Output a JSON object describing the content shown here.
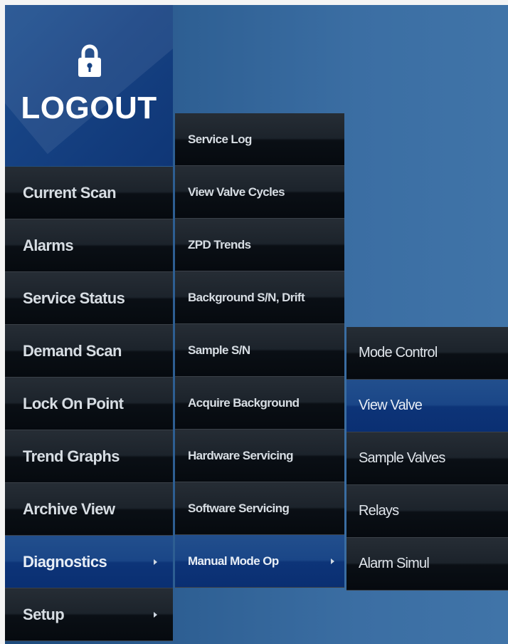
{
  "logout": {
    "label": "LOGOUT",
    "icon": "lock-icon"
  },
  "main_menu": [
    {
      "label": "Current Scan",
      "active": false,
      "has_submenu": false
    },
    {
      "label": "Alarms",
      "active": false,
      "has_submenu": false
    },
    {
      "label": "Service Status",
      "active": false,
      "has_submenu": false
    },
    {
      "label": "Demand Scan",
      "active": false,
      "has_submenu": false
    },
    {
      "label": "Lock On Point",
      "active": false,
      "has_submenu": false
    },
    {
      "label": "Trend Graphs",
      "active": false,
      "has_submenu": false
    },
    {
      "label": "Archive View",
      "active": false,
      "has_submenu": false
    },
    {
      "label": "Diagnostics",
      "active": true,
      "has_submenu": true
    },
    {
      "label": "Setup",
      "active": false,
      "has_submenu": true
    }
  ],
  "diagnostics_menu": [
    {
      "label": "Service Log",
      "active": false
    },
    {
      "label": "View Valve Cycles",
      "active": false
    },
    {
      "label": "ZPD Trends",
      "active": false
    },
    {
      "label": "Background S/N, Drift",
      "active": false
    },
    {
      "label": "Sample S/N",
      "active": false
    },
    {
      "label": "Acquire Background",
      "active": false
    },
    {
      "label": "Hardware Servicing",
      "active": false
    },
    {
      "label": "Software Servicing",
      "active": false
    },
    {
      "label": "Manual Mode Op",
      "active": true,
      "has_submenu": true
    }
  ],
  "manual_mode_menu": [
    {
      "label": "Mode Control",
      "active": false
    },
    {
      "label": "View Valve",
      "active": true
    },
    {
      "label": "Sample Valves",
      "active": false
    },
    {
      "label": "Relays",
      "active": false
    },
    {
      "label": "Alarm Simul",
      "active": false
    }
  ],
  "colors": {
    "accent_blue": "#164283",
    "menu_dark": "#1c232b",
    "text_light": "#d7dde3",
    "background_blue": "#2e5f93"
  }
}
